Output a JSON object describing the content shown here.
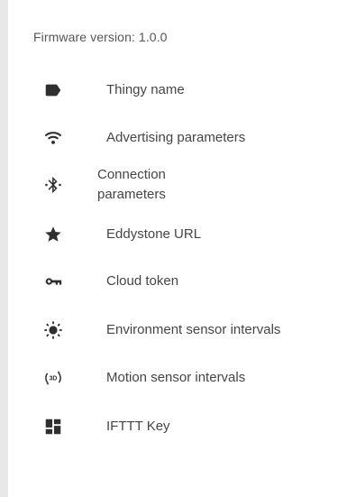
{
  "firmware_text": "Firmware version: 1.0.0",
  "menu": [
    {
      "label": "Thingy name",
      "icon": "label-tag-icon"
    },
    {
      "label": "Advertising parameters",
      "icon": "wifi-icon"
    },
    {
      "label": "Connection parameters",
      "icon": "bluetooth-searching-icon"
    },
    {
      "label": "Eddystone URL",
      "icon": "star-icon"
    },
    {
      "label": "Cloud token",
      "icon": "key-icon"
    },
    {
      "label": "Environment sensor intervals",
      "icon": "sun-icon"
    },
    {
      "label": "Motion sensor intervals",
      "icon": "3d-rotation-icon"
    },
    {
      "label": "IFTTT Key",
      "icon": "dashboard-grid-icon"
    }
  ]
}
